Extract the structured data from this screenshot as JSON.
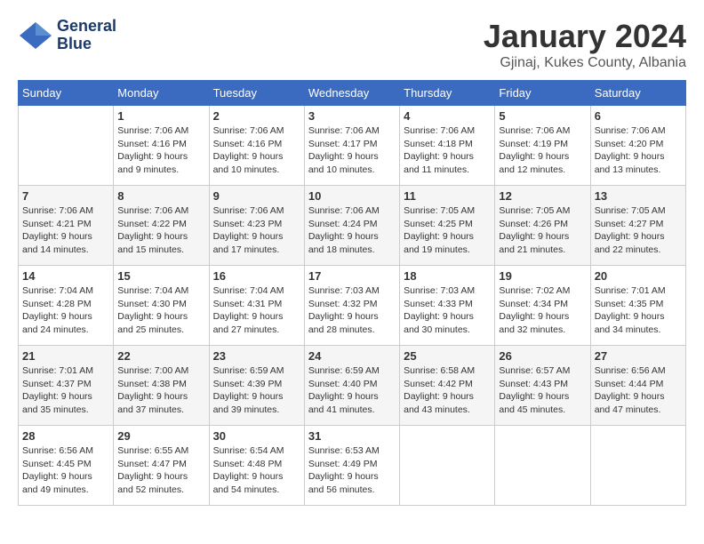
{
  "header": {
    "logo": {
      "line1": "General",
      "line2": "Blue"
    },
    "title": "January 2024",
    "subtitle": "Gjinaj, Kukes County, Albania"
  },
  "weekdays": [
    "Sunday",
    "Monday",
    "Tuesday",
    "Wednesday",
    "Thursday",
    "Friday",
    "Saturday"
  ],
  "weeks": [
    [
      {
        "day": "",
        "sunrise": "",
        "sunset": "",
        "daylight": ""
      },
      {
        "day": "1",
        "sunrise": "Sunrise: 7:06 AM",
        "sunset": "Sunset: 4:16 PM",
        "daylight": "Daylight: 9 hours and 9 minutes."
      },
      {
        "day": "2",
        "sunrise": "Sunrise: 7:06 AM",
        "sunset": "Sunset: 4:16 PM",
        "daylight": "Daylight: 9 hours and 10 minutes."
      },
      {
        "day": "3",
        "sunrise": "Sunrise: 7:06 AM",
        "sunset": "Sunset: 4:17 PM",
        "daylight": "Daylight: 9 hours and 10 minutes."
      },
      {
        "day": "4",
        "sunrise": "Sunrise: 7:06 AM",
        "sunset": "Sunset: 4:18 PM",
        "daylight": "Daylight: 9 hours and 11 minutes."
      },
      {
        "day": "5",
        "sunrise": "Sunrise: 7:06 AM",
        "sunset": "Sunset: 4:19 PM",
        "daylight": "Daylight: 9 hours and 12 minutes."
      },
      {
        "day": "6",
        "sunrise": "Sunrise: 7:06 AM",
        "sunset": "Sunset: 4:20 PM",
        "daylight": "Daylight: 9 hours and 13 minutes."
      }
    ],
    [
      {
        "day": "7",
        "sunrise": "Sunrise: 7:06 AM",
        "sunset": "Sunset: 4:21 PM",
        "daylight": "Daylight: 9 hours and 14 minutes."
      },
      {
        "day": "8",
        "sunrise": "Sunrise: 7:06 AM",
        "sunset": "Sunset: 4:22 PM",
        "daylight": "Daylight: 9 hours and 15 minutes."
      },
      {
        "day": "9",
        "sunrise": "Sunrise: 7:06 AM",
        "sunset": "Sunset: 4:23 PM",
        "daylight": "Daylight: 9 hours and 17 minutes."
      },
      {
        "day": "10",
        "sunrise": "Sunrise: 7:06 AM",
        "sunset": "Sunset: 4:24 PM",
        "daylight": "Daylight: 9 hours and 18 minutes."
      },
      {
        "day": "11",
        "sunrise": "Sunrise: 7:05 AM",
        "sunset": "Sunset: 4:25 PM",
        "daylight": "Daylight: 9 hours and 19 minutes."
      },
      {
        "day": "12",
        "sunrise": "Sunrise: 7:05 AM",
        "sunset": "Sunset: 4:26 PM",
        "daylight": "Daylight: 9 hours and 21 minutes."
      },
      {
        "day": "13",
        "sunrise": "Sunrise: 7:05 AM",
        "sunset": "Sunset: 4:27 PM",
        "daylight": "Daylight: 9 hours and 22 minutes."
      }
    ],
    [
      {
        "day": "14",
        "sunrise": "Sunrise: 7:04 AM",
        "sunset": "Sunset: 4:28 PM",
        "daylight": "Daylight: 9 hours and 24 minutes."
      },
      {
        "day": "15",
        "sunrise": "Sunrise: 7:04 AM",
        "sunset": "Sunset: 4:30 PM",
        "daylight": "Daylight: 9 hours and 25 minutes."
      },
      {
        "day": "16",
        "sunrise": "Sunrise: 7:04 AM",
        "sunset": "Sunset: 4:31 PM",
        "daylight": "Daylight: 9 hours and 27 minutes."
      },
      {
        "day": "17",
        "sunrise": "Sunrise: 7:03 AM",
        "sunset": "Sunset: 4:32 PM",
        "daylight": "Daylight: 9 hours and 28 minutes."
      },
      {
        "day": "18",
        "sunrise": "Sunrise: 7:03 AM",
        "sunset": "Sunset: 4:33 PM",
        "daylight": "Daylight: 9 hours and 30 minutes."
      },
      {
        "day": "19",
        "sunrise": "Sunrise: 7:02 AM",
        "sunset": "Sunset: 4:34 PM",
        "daylight": "Daylight: 9 hours and 32 minutes."
      },
      {
        "day": "20",
        "sunrise": "Sunrise: 7:01 AM",
        "sunset": "Sunset: 4:35 PM",
        "daylight": "Daylight: 9 hours and 34 minutes."
      }
    ],
    [
      {
        "day": "21",
        "sunrise": "Sunrise: 7:01 AM",
        "sunset": "Sunset: 4:37 PM",
        "daylight": "Daylight: 9 hours and 35 minutes."
      },
      {
        "day": "22",
        "sunrise": "Sunrise: 7:00 AM",
        "sunset": "Sunset: 4:38 PM",
        "daylight": "Daylight: 9 hours and 37 minutes."
      },
      {
        "day": "23",
        "sunrise": "Sunrise: 6:59 AM",
        "sunset": "Sunset: 4:39 PM",
        "daylight": "Daylight: 9 hours and 39 minutes."
      },
      {
        "day": "24",
        "sunrise": "Sunrise: 6:59 AM",
        "sunset": "Sunset: 4:40 PM",
        "daylight": "Daylight: 9 hours and 41 minutes."
      },
      {
        "day": "25",
        "sunrise": "Sunrise: 6:58 AM",
        "sunset": "Sunset: 4:42 PM",
        "daylight": "Daylight: 9 hours and 43 minutes."
      },
      {
        "day": "26",
        "sunrise": "Sunrise: 6:57 AM",
        "sunset": "Sunset: 4:43 PM",
        "daylight": "Daylight: 9 hours and 45 minutes."
      },
      {
        "day": "27",
        "sunrise": "Sunrise: 6:56 AM",
        "sunset": "Sunset: 4:44 PM",
        "daylight": "Daylight: 9 hours and 47 minutes."
      }
    ],
    [
      {
        "day": "28",
        "sunrise": "Sunrise: 6:56 AM",
        "sunset": "Sunset: 4:45 PM",
        "daylight": "Daylight: 9 hours and 49 minutes."
      },
      {
        "day": "29",
        "sunrise": "Sunrise: 6:55 AM",
        "sunset": "Sunset: 4:47 PM",
        "daylight": "Daylight: 9 hours and 52 minutes."
      },
      {
        "day": "30",
        "sunrise": "Sunrise: 6:54 AM",
        "sunset": "Sunset: 4:48 PM",
        "daylight": "Daylight: 9 hours and 54 minutes."
      },
      {
        "day": "31",
        "sunrise": "Sunrise: 6:53 AM",
        "sunset": "Sunset: 4:49 PM",
        "daylight": "Daylight: 9 hours and 56 minutes."
      },
      {
        "day": "",
        "sunrise": "",
        "sunset": "",
        "daylight": ""
      },
      {
        "day": "",
        "sunrise": "",
        "sunset": "",
        "daylight": ""
      },
      {
        "day": "",
        "sunrise": "",
        "sunset": "",
        "daylight": ""
      }
    ]
  ]
}
